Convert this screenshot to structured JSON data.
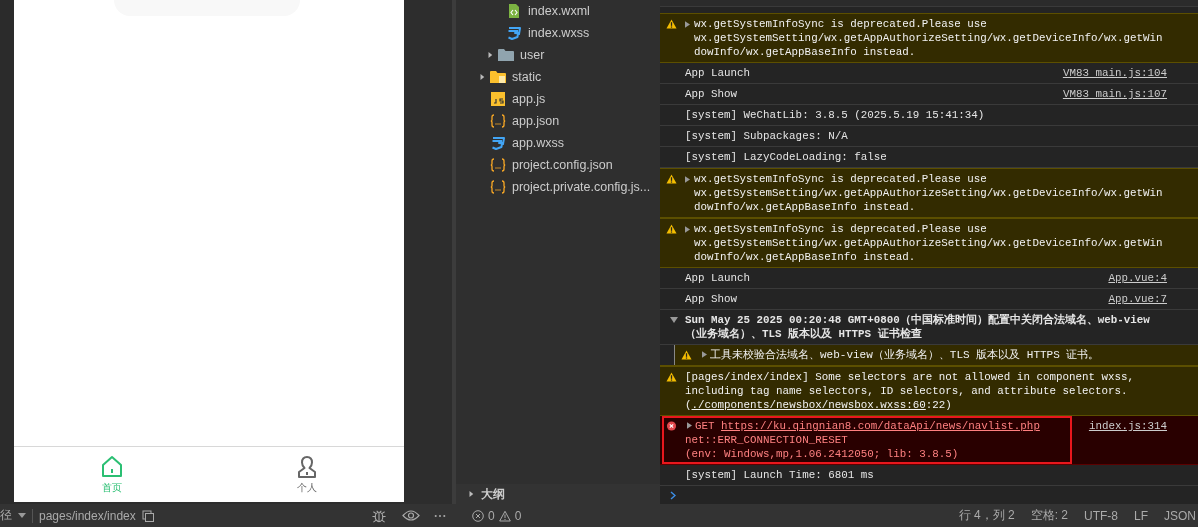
{
  "phone": {
    "tabs": [
      {
        "label": "首页",
        "kind": "home",
        "selected": true
      },
      {
        "label": "个人",
        "kind": "person",
        "selected": false
      }
    ]
  },
  "file_tree": {
    "items": [
      {
        "children": [
          {
            "children": [
              {
                "name": "index.wxml",
                "kind": "wxml"
              },
              {
                "name": "index.wxss",
                "kind": "wxss"
              }
            ]
          },
          {
            "name": "user",
            "kind": "folder",
            "expanded": false
          }
        ]
      },
      {
        "name": "static",
        "kind": "assets-folder",
        "expanded": false
      },
      {
        "name": "app.js",
        "kind": "js"
      },
      {
        "name": "app.json",
        "kind": "json"
      },
      {
        "name": "app.wxss",
        "kind": "wxss"
      },
      {
        "name": "project.config.json",
        "kind": "json"
      },
      {
        "name": "project.private.config.js...",
        "kind": "json"
      }
    ],
    "outline": {
      "label": "大纲",
      "expanded": false
    }
  },
  "console": {
    "messages": [
      {
        "kind": "warning",
        "expandable": true,
        "text": "wx.getSystemInfoSync is deprecated.Please use wx.getSystemSetting/wx.getAppAuthorizeSetting/wx.getDeviceInfo/wx.getWindowInfo/wx.getAppBaseInfo instead."
      },
      {
        "kind": "log",
        "text": "App Launch",
        "source": "VM83 main.js:104"
      },
      {
        "kind": "log",
        "text": "App Show",
        "source": "VM83 main.js:107"
      },
      {
        "kind": "log",
        "text": "[system] WeChatLib: 3.8.5 (2025.5.19 15:41:34)"
      },
      {
        "kind": "log",
        "text": "[system] Subpackages: N/A"
      },
      {
        "kind": "log",
        "text": "[system] LazyCodeLoading: false"
      },
      {
        "kind": "warning",
        "expandable": true,
        "text": "wx.getSystemInfoSync is deprecated.Please use wx.getSystemSetting/wx.getAppAuthorizeSetting/wx.getDeviceInfo/wx.getWindowInfo/wx.getAppBaseInfo instead."
      },
      {
        "kind": "warning",
        "expandable": true,
        "text": "wx.getSystemInfoSync is deprecated.Please use wx.getSystemSetting/wx.getAppAuthorizeSetting/wx.getDeviceInfo/wx.getWindowInfo/wx.getAppBaseInfo instead."
      },
      {
        "kind": "log",
        "text": "App Launch",
        "source": "App.vue:4"
      },
      {
        "kind": "log",
        "text": "App Show",
        "source": "App.vue:7"
      },
      {
        "kind": "group",
        "expanded": true,
        "text": "Sun May 25 2025 00:20:48 GMT+0800（中国标准时间）配置中关闭合法域名、web-view（业务域名）、TLS 版本以及 HTTPS 证书检查",
        "children": [
          {
            "kind": "warning",
            "expandable": true,
            "text": "工具未校验合法域名、web-view（业务域名）、TLS 版本以及 HTTPS 证书。"
          }
        ]
      },
      {
        "kind": "warning",
        "expandable": false,
        "text": "[pages/index/index] Some selectors are not allowed in component wxss, including tag name selectors, ID selectors, and attribute selectors.(",
        "link": "./components/newsbox/newsbox.wxss:60",
        "after": ":22)"
      },
      {
        "kind": "error",
        "expandable": true,
        "highlighted": true,
        "method": "GET",
        "url": "https://ku.qingnian8.com/dataApi/news/navlist.php",
        "lines": [
          "net::ERR_CONNECTION_RESET",
          "(env: Windows,mp,1.06.2412050; lib: 3.8.5)"
        ],
        "source": "index.js:314"
      },
      {
        "kind": "log",
        "text": "[system] Launch Time: 6801 ms"
      }
    ]
  },
  "status_bar": {
    "path_label": "径",
    "path": "pages/index/index",
    "errors": "0",
    "warnings": "0",
    "cursor": "行 4，列 2",
    "indent": "空格: 2",
    "encoding": "UTF-8",
    "eol": "LF",
    "language": "JSON"
  }
}
